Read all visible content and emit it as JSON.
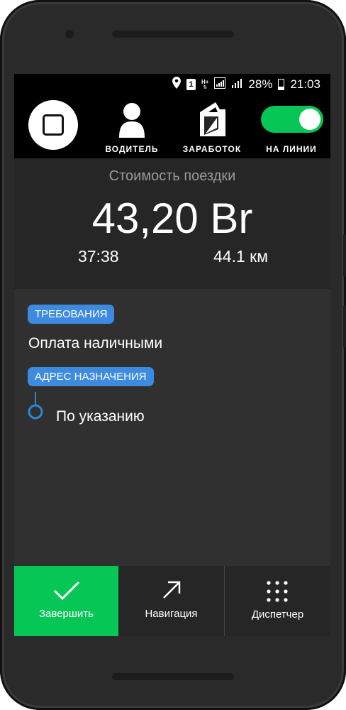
{
  "status_bar": {
    "sim_slot": "1",
    "network_type": "H+",
    "battery_percent": "28%",
    "time": "21:03",
    "icons": [
      "location-icon",
      "sim-icon",
      "signal-icon",
      "battery-icon"
    ]
  },
  "toolbar": {
    "driver_label": "ВОДИТЕЛЬ",
    "earnings_label": "ЗАРАБОТОК",
    "online_label": "НА ЛИНИИ",
    "online_enabled": true
  },
  "trip": {
    "cost_caption": "Стоимость поездки",
    "cost_amount": "43,20 Br",
    "duration": "37:38",
    "distance": "44.1 км"
  },
  "details": {
    "requirements_tag": "ТРЕБОВАНИЯ",
    "payment_method": "Оплата наличными",
    "destination_tag": "АДРЕС НАЗНАЧЕНИЯ",
    "destination": "По указанию"
  },
  "bottom_bar": {
    "finish_label": "Завершить",
    "navigation_label": "Навигация",
    "dispatcher_label": "Диспетчер"
  },
  "colors": {
    "accent_green": "#06c755",
    "tag_blue": "#3d8be0",
    "route_blue": "#2f86d6",
    "background": "#262626"
  }
}
